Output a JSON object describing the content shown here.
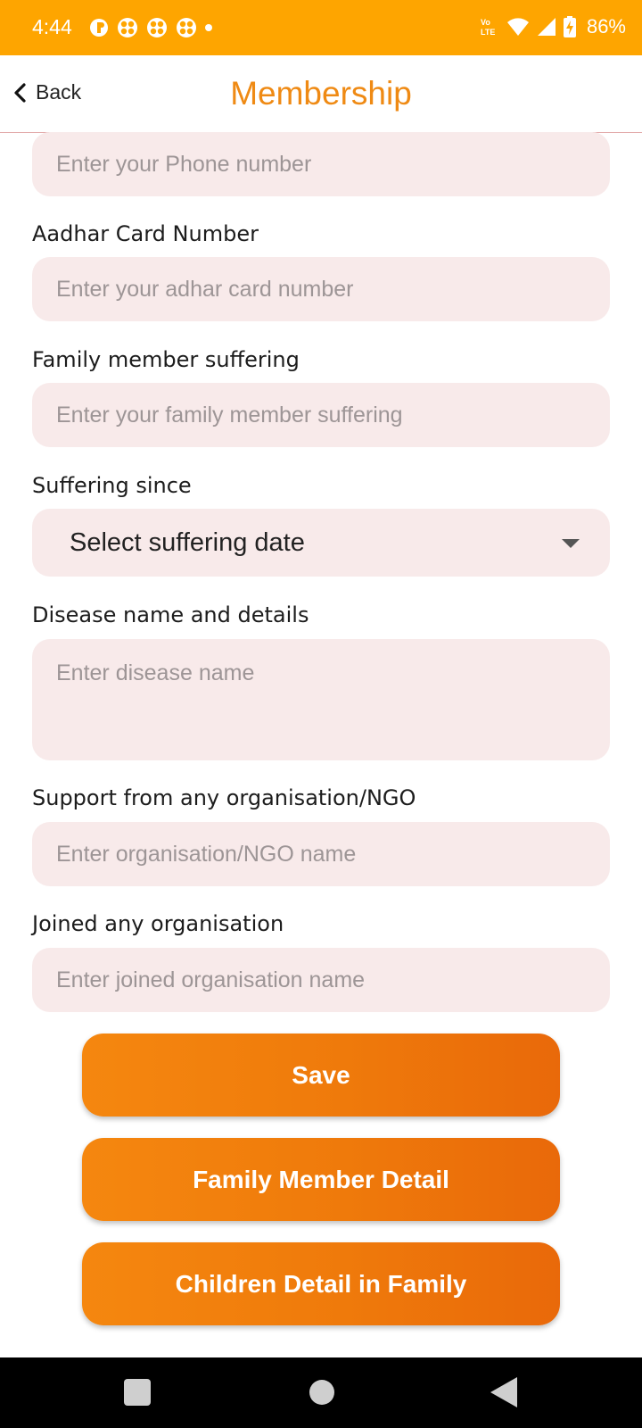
{
  "status_bar": {
    "time": "4:44",
    "battery": "86%",
    "icons": [
      "app-notification-icon",
      "pinwheel-icon",
      "pinwheel-icon",
      "pinwheel-icon",
      "dot-icon",
      "volte-icon",
      "wifi-icon",
      "signal-icon",
      "battery-charging-icon"
    ],
    "volte_text": "VoLTE"
  },
  "header": {
    "back_label": "Back",
    "title": "Membership"
  },
  "form": {
    "phone": {
      "placeholder": "Enter your Phone number"
    },
    "aadhar": {
      "label": "Aadhar Card Number",
      "placeholder": "Enter your adhar card number"
    },
    "family_member": {
      "label": "Family member suffering",
      "placeholder": "Enter your family member suffering"
    },
    "suffering_since": {
      "label": "Suffering since",
      "value": "Select suffering date"
    },
    "disease": {
      "label": "Disease name and details",
      "placeholder": "Enter disease name"
    },
    "support_org": {
      "label": "Support from any organisation/NGO",
      "placeholder": "Enter organisation/NGO name"
    },
    "joined_org": {
      "label": "Joined any organisation",
      "placeholder": "Enter joined organisation name"
    }
  },
  "buttons": {
    "save": "Save",
    "family_member_detail": "Family Member Detail",
    "children_detail": "Children Detail in Family"
  },
  "colors": {
    "status_bar": "#fea500",
    "accent": "#ef8a14",
    "field_bg": "#f8eaea",
    "button_start": "#f5870f",
    "button_end": "#e9690a"
  }
}
